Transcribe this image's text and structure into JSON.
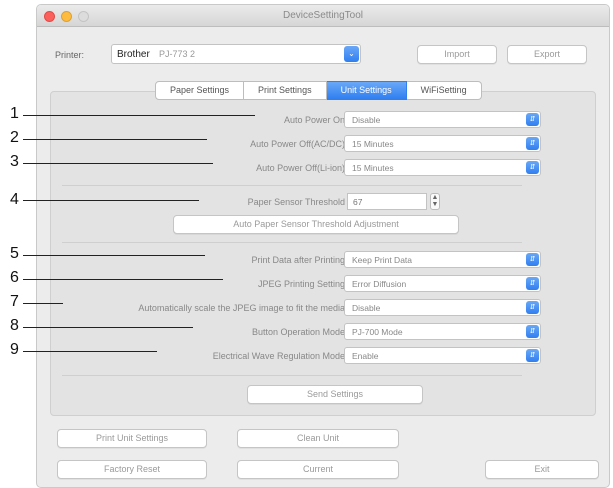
{
  "window": {
    "title": "DeviceSettingTool"
  },
  "printer": {
    "label": "Printer:",
    "brand": "Brother",
    "model": "PJ-773 2"
  },
  "header_buttons": {
    "import": "Import",
    "export": "Export"
  },
  "tabs": [
    {
      "label": "Paper Settings",
      "active": false
    },
    {
      "label": "Print Settings",
      "active": false
    },
    {
      "label": "Unit Settings",
      "active": true
    },
    {
      "label": "WiFiSetting",
      "active": false
    }
  ],
  "settings": [
    {
      "callout": "1",
      "label": "Auto Power On",
      "value": "Disable"
    },
    {
      "callout": "2",
      "label": "Auto Power Off(AC/DC)",
      "value": "15 Minutes"
    },
    {
      "callout": "3",
      "label": "Auto Power Off(Li-ion)",
      "value": "15 Minutes"
    },
    {
      "callout": "4",
      "label": "Paper Sensor Threshold",
      "value": "67"
    },
    {
      "callout": "5",
      "label": "Print Data after Printing",
      "value": "Keep Print Data"
    },
    {
      "callout": "6",
      "label": "JPEG Printing Setting",
      "value": "Error Diffusion"
    },
    {
      "callout": "7",
      "label": "Automatically scale the JPEG image to fit the media",
      "value": "Disable"
    },
    {
      "callout": "8",
      "label": "Button Operation Mode",
      "value": "PJ-700 Mode"
    },
    {
      "callout": "9",
      "label": "Electrical Wave Regulation Mode",
      "value": "Enable"
    }
  ],
  "threshold_adjust_button": "Auto Paper Sensor Threshold Adjustment",
  "send_button": "Send Settings",
  "footer": {
    "print_unit_settings": "Print Unit Settings",
    "clean_unit": "Clean Unit",
    "factory_reset": "Factory Reset",
    "current": "Current",
    "exit": "Exit"
  },
  "colors": {
    "accent": "#2f7ff1",
    "panel": "#e3e3e3"
  }
}
